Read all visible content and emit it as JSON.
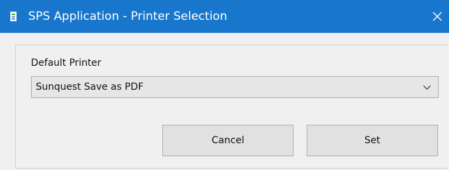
{
  "window": {
    "title": "SPS Application - Printer Selection",
    "title_bar_color": "#1877cc",
    "icon": "app-window-icon",
    "close_icon": "close-icon"
  },
  "form": {
    "printer_label": "Default Printer",
    "printer_select": {
      "selected": "Sunquest Save as PDF",
      "icon": "chevron-down-icon"
    }
  },
  "buttons": {
    "cancel_label": "Cancel",
    "set_label": "Set"
  }
}
